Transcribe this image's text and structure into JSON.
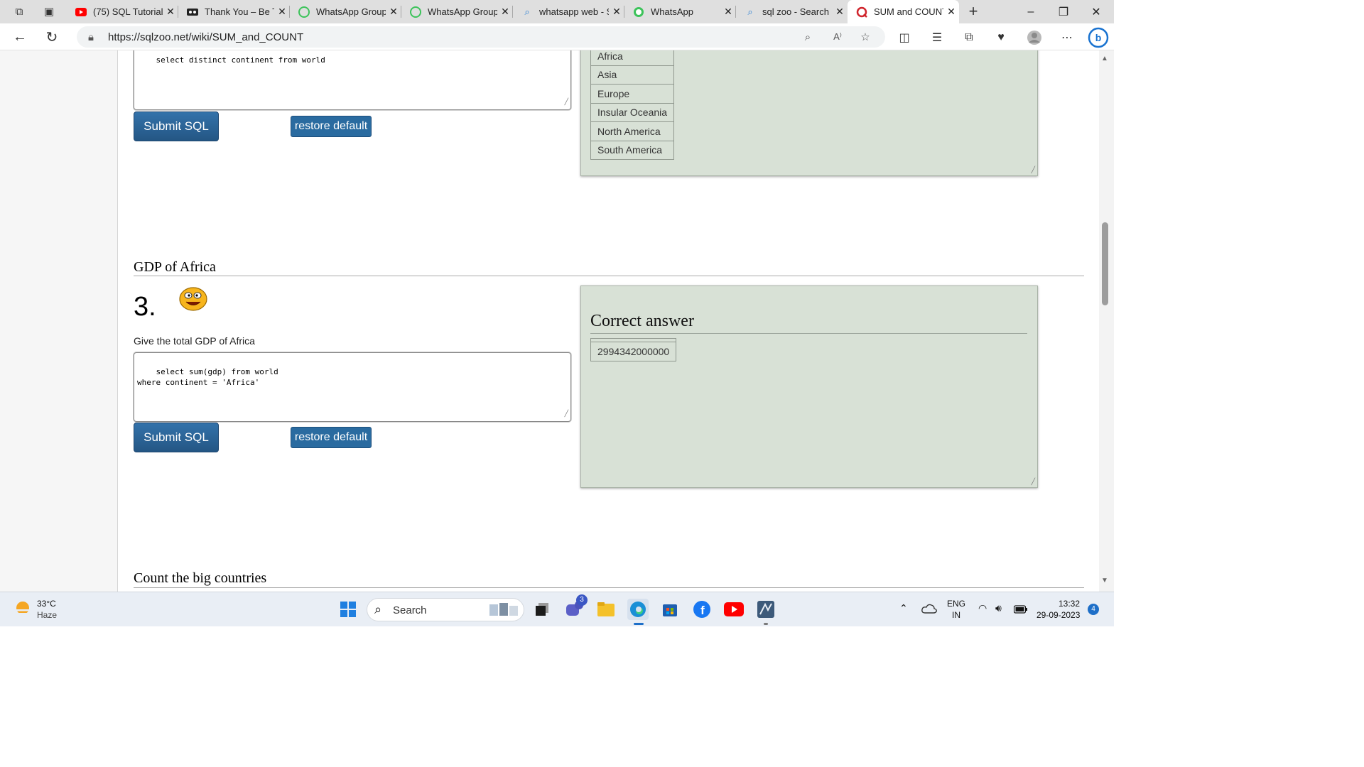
{
  "tabs": [
    {
      "title": "(75) SQL Tutorial",
      "favicon": "youtube-icon"
    },
    {
      "title": "Thank You – Be The",
      "favicon": "site-icon"
    },
    {
      "title": "WhatsApp Group",
      "favicon": "whatsapp-icon"
    },
    {
      "title": "WhatsApp Group",
      "favicon": "whatsapp-icon"
    },
    {
      "title": "whatsapp web - Search",
      "favicon": "search-icon"
    },
    {
      "title": "WhatsApp",
      "favicon": "whatsapp-icon"
    },
    {
      "title": "sql zoo - Search",
      "favicon": "search-icon"
    },
    {
      "title": "SUM and COUNT",
      "favicon": "sqlzoo-icon",
      "active": true
    }
  ],
  "address": {
    "url": "https://sqlzoo.net/wiki/SUM_and_COUNT"
  },
  "prev_section": {
    "sql_partial": "select distinct continent from world",
    "submit_label": "Submit SQL",
    "restore_label": "restore default",
    "result_rows": [
      "Africa",
      "Asia",
      "Europe",
      "Insular Oceania",
      "North America",
      "South America"
    ]
  },
  "section3": {
    "heading": "GDP of Africa",
    "number": "3.",
    "status_icon": "smiley-icon",
    "question": "Give the total GDP of Africa",
    "sql": "select sum(gdp) from world\nwhere continent = 'Africa'",
    "submit_label": "Submit SQL",
    "restore_label": "restore default",
    "result_title": "Correct answer",
    "result_value": "2994342000000"
  },
  "next_section": {
    "heading": "Count the big countries"
  },
  "taskbar": {
    "weather_temp": "33°C",
    "weather_desc": "Haze",
    "search_placeholder": "Search",
    "teams_badge": "3",
    "lang_line1": "ENG",
    "lang_line2": "IN",
    "time": "13:32",
    "date": "29-09-2023",
    "notif_count": "4"
  },
  "colors": {
    "button_blue": "#265a88",
    "result_panel": "#d8e1d6",
    "tab_strip": "#dfdfdf",
    "taskbar": "#e9eef5"
  }
}
